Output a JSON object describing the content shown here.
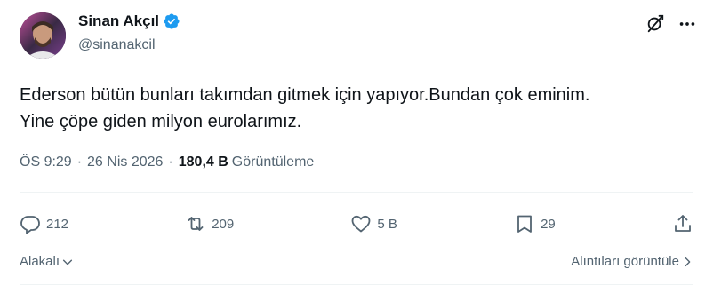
{
  "author": {
    "name": "Sinan Akçıl",
    "handle": "@sinanakcil"
  },
  "tweet": {
    "text": "Ederson bütün bunları takımdan gitmek için yapıyor.Bundan çok eminim.\nYine çöpe giden milyon eurolarımız.",
    "time": "ÖS 9:29",
    "date": "26 Nis 2026",
    "separator": "·",
    "views_count": "180,4 B",
    "views_label": "Görüntüleme"
  },
  "actions": {
    "replies": "212",
    "reposts": "209",
    "likes": "5 B",
    "bookmarks": "29"
  },
  "footer": {
    "sort_label": "Alakalı",
    "quotes_label": "Alıntıları görüntüle"
  },
  "icons": {
    "verified": "verified-badge-icon",
    "grok": "grok-icon",
    "more": "more-icon",
    "reply": "reply-icon",
    "repost": "repost-icon",
    "like": "heart-icon",
    "bookmark": "bookmark-icon",
    "share": "share-icon"
  },
  "colors": {
    "verified_blue": "#1d9bf0",
    "secondary_text": "#536471",
    "primary_text": "#0f1419"
  }
}
